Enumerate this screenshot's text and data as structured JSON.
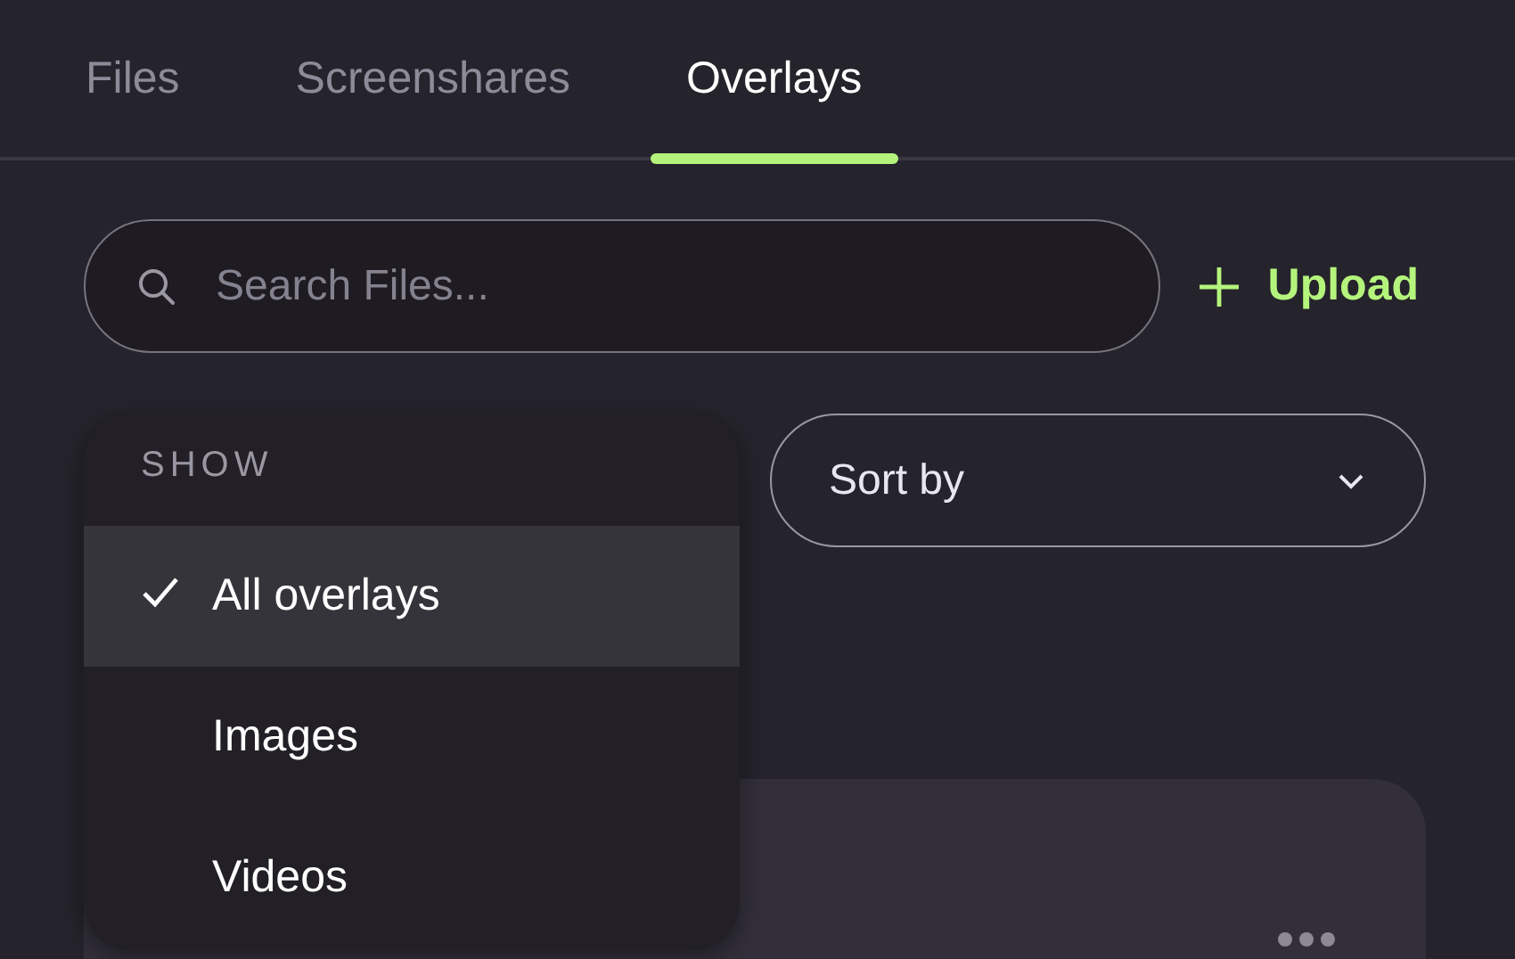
{
  "tabs": [
    {
      "label": "Files",
      "selected": false
    },
    {
      "label": "Screenshares",
      "selected": false
    },
    {
      "label": "Overlays",
      "selected": true
    }
  ],
  "search": {
    "placeholder": "Search Files..."
  },
  "upload": {
    "label": "Upload"
  },
  "sort": {
    "label": "Sort by"
  },
  "show_menu": {
    "header": "SHOW",
    "items": [
      {
        "label": "All overlays",
        "selected": true
      },
      {
        "label": "Images",
        "selected": false
      },
      {
        "label": "Videos",
        "selected": false
      }
    ]
  }
}
